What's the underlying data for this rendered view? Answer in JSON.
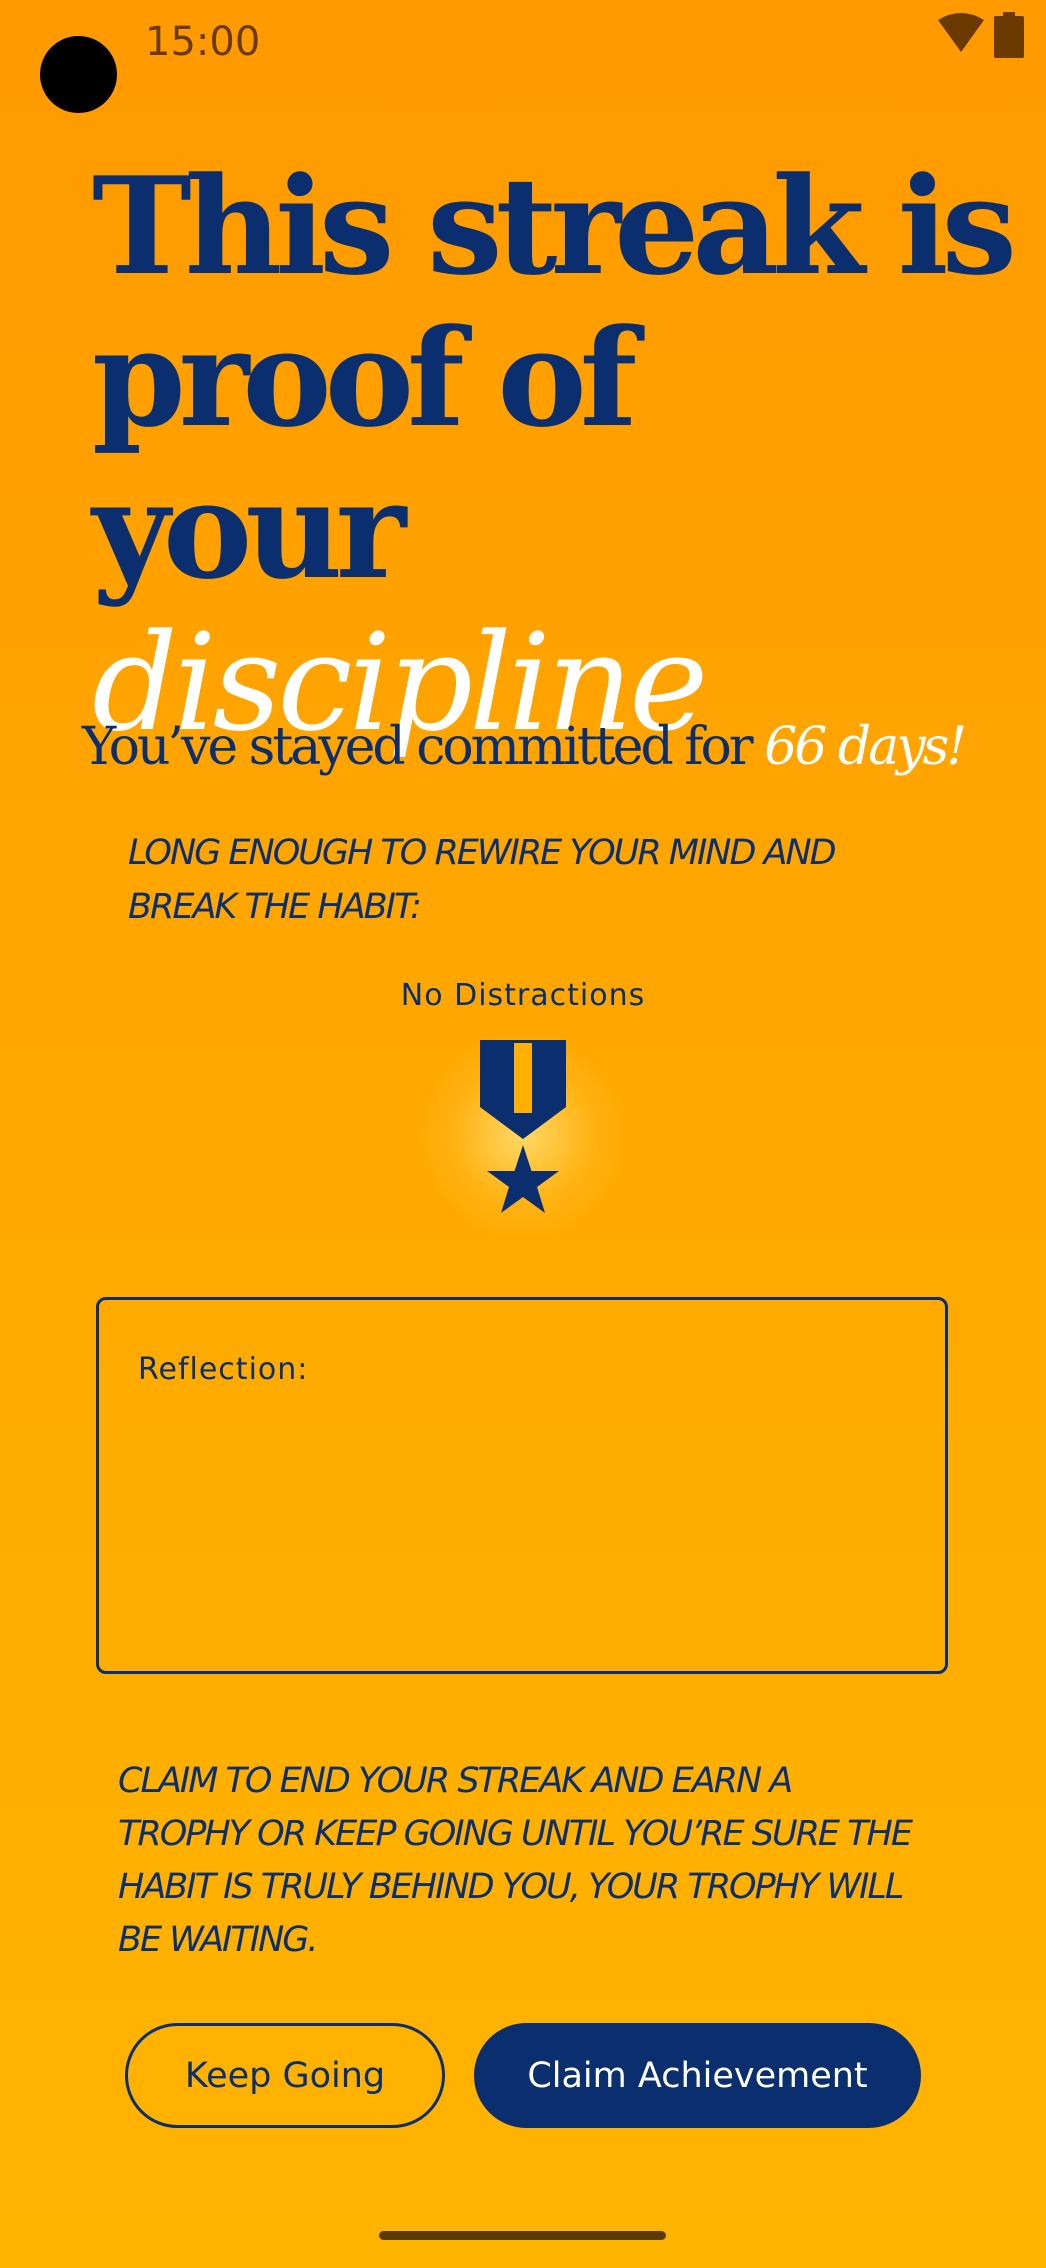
{
  "status_bar": {
    "time": "15:00",
    "icons": [
      "wifi-icon",
      "battery-icon"
    ]
  },
  "headline": {
    "line1": "This streak is",
    "line2": "proof of",
    "line3_plain": "your",
    "line3_emphasis": "discipline"
  },
  "subline": {
    "text": "You’ve stayed committed for",
    "days": "66 days!"
  },
  "rewire_note": {
    "line1": "LONG ENOUGH TO REWIRE YOUR MIND AND",
    "line2": "BREAK THE HABIT:"
  },
  "badge": {
    "title": "No Distractions",
    "icon": "medal-icon"
  },
  "reflection": {
    "label": "Reflection:"
  },
  "claim_note": {
    "line1": "CLAIM TO END YOUR STREAK AND EARN A",
    "line2": "TROPHY OR KEEP GOING UNTIL YOU’RE SURE THE",
    "line3": "HABIT IS TRULY BEHIND YOU, YOUR TROPHY WILL",
    "line4": "BE WAITING."
  },
  "buttons": {
    "keep_going": "Keep Going",
    "claim": "Claim Achievement"
  },
  "colors": {
    "background_top": "#FF9A00",
    "background_bottom": "#FFB400",
    "primary_navy": "#0A2E6E",
    "emphasis_white": "#FFFFFF"
  }
}
